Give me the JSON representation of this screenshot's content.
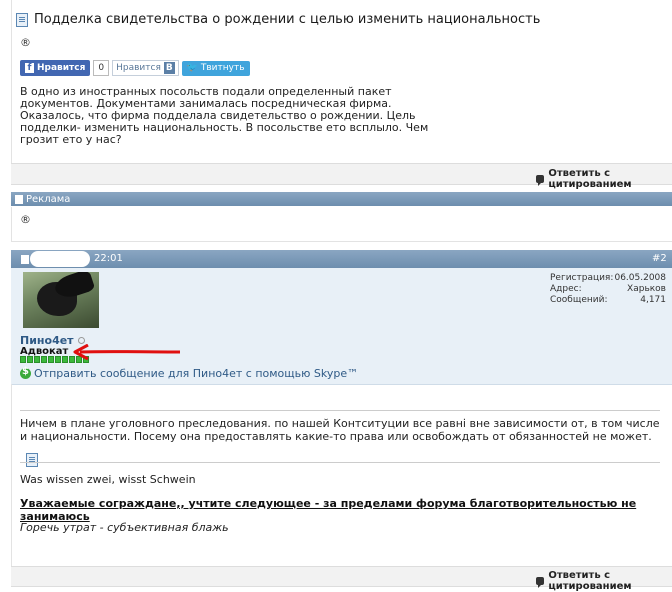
{
  "post1": {
    "title": "Подделка свидетельства о рождении с целью изменить национальность",
    "reg_mark": "®",
    "share": {
      "facebook_label": "Нравится",
      "vk_count": "0",
      "vk_label": "Нравится",
      "vk_letter": "В",
      "twitter_label": "Твитнуть"
    },
    "body": "В одно из иностранных посольств подали определенный пакет документов. Документами занималась посредническая фирма. Оказалось, что фирма подделала свидетельство о рождении. Цель подделки- изменить национальность. В посольстве ето всплыло. Чем грозит ето у нас?",
    "quote_label": "Ответить с цитированием"
  },
  "ad": {
    "label": "Реклама",
    "reg_mark": "®"
  },
  "post2": {
    "time": "22:01",
    "number": "#2",
    "username": "Пино4ет",
    "usertitle": "Адвокат",
    "skype_link": "Отправить сообщение для Пино4ет с помощью Skype™",
    "stats": [
      {
        "label": "Регистрация:",
        "value": "06.05.2008"
      },
      {
        "label": "Адрес:",
        "value": "Харьков"
      },
      {
        "label": "Сообщений:",
        "value": "4,171"
      }
    ],
    "body": "Ничем в плане уголовного преследования. по нашей Контситуции все равні вне зависимости от, в том числе и национальности. Посему она предоставлять какие-то права или освобождать от обязанностей не может.",
    "signature": {
      "line1": "Was wissen zwei, wisst Schwein",
      "line2": "Уважаемые сограждане,, учтите следующее - за пределами форума благотворительностью не занимаюсь",
      "line3": "Горечь утрат - субъективная блажь"
    },
    "quote_label": "Ответить с цитированием"
  },
  "colors": {
    "header_bar": "#7896b4",
    "user_panel": "#e8f0f7",
    "link": "#2f5a86",
    "arrow": "#e01010"
  }
}
